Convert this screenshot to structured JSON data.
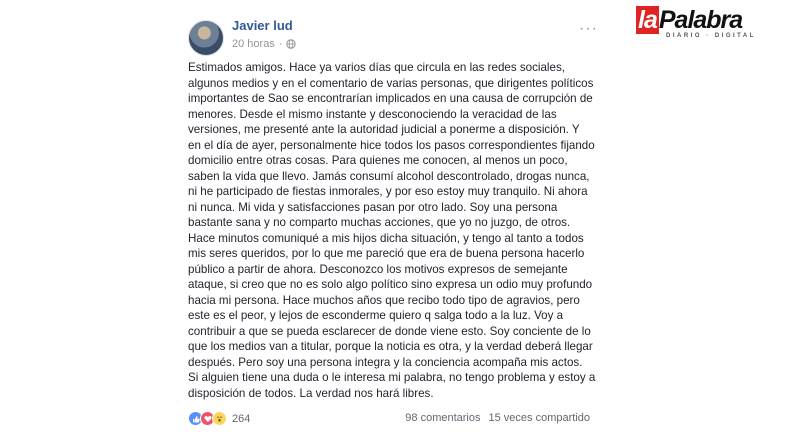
{
  "post": {
    "author": "Javier lud",
    "time": "20 horas",
    "more_label": "···",
    "text": "Estimados amigos. Hace ya varios días que circula en las redes sociales,\nalgunos medios y en el comentario de varias personas, que dirigentes políticos\nimportantes de Sao se encontrarían implicados en una causa de corrupción de\nmenores. Desde el mismo instante y desconociendo la veracidad de las\nversiones, me presenté ante la autoridad judicial a ponerme a disposición. Y\nen el día de ayer, personalmente hice todos los pasos correspondientes fijando\ndomicilio entre otras cosas. Para quienes me conocen, al menos un poco,\nsaben la vida que llevo. Jamás consumí alcohol descontrolado, drogas nunca,\nni he participado de fiestas inmorales, y por eso estoy muy tranquilo. Ni ahora\nni nunca. Mi vida y satisfacciones pasan por otro lado. Soy una persona\nbastante sana y no comparto muchas acciones, que yo no juzgo, de otros.\nHace minutos comuniqué a mis hijos dicha situación, y tengo al tanto a todos\nmis seres queridos, por lo que me pareció que era de buena persona hacerlo\npúblico a partir de ahora. Desconozco los motivos expresos de semejante\nataque, si creo que no es solo algo político sino expresa un odio muy profundo\nhacia mi persona. Hace muchos años que recibo todo tipo de agravios, pero\neste es el peor, y lejos de esconderme quiero q salga todo a la luz. Voy a\ncontribuir a que se pueda esclarecer de donde viene esto. Soy conciente de lo\nque los medios van a titular, porque la noticia es otra, y la verdad deberá llegar\ndespués. Pero soy una persona integra y la conciencia acompaña mis actos.\nSi alguien tiene una duda o le interesa mi palabra, no tengo problema y estoy a\ndisposición de todos. La verdad nos hará libres.",
    "reaction_count": "264",
    "comments": "98 comentarios",
    "shares": "15 veces compartido"
  },
  "logo": {
    "la": "la",
    "palabra": "Palabra",
    "subtitle": "DIARIO · DIGITAL"
  },
  "icons": [
    "globe-icon",
    "more-icon",
    "like-reaction-icon",
    "love-reaction-icon",
    "wow-reaction-icon"
  ],
  "colors": {
    "author": "#365899",
    "text": "#1d2129",
    "meta": "#90949c",
    "logo_red": "#e02424"
  }
}
